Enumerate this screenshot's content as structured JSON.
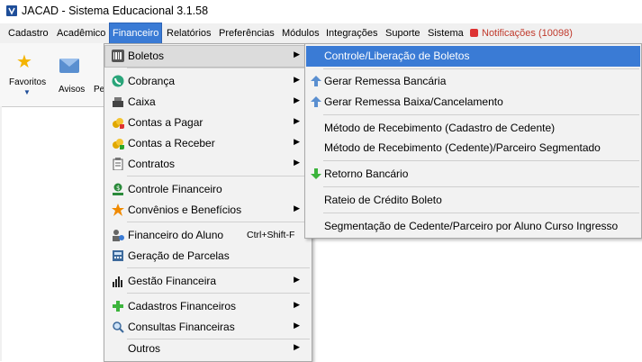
{
  "window": {
    "title": "JACAD - Sistema Educacional 3.1.58",
    "app_icon_color": "#1f4e99"
  },
  "menubar": {
    "items": [
      {
        "label": "Cadastro"
      },
      {
        "label": "Acadêmico"
      },
      {
        "label": "Financeiro",
        "active": true
      },
      {
        "label": "Relatórios"
      },
      {
        "label": "Preferências"
      },
      {
        "label": "Módulos"
      },
      {
        "label": "Integrações"
      },
      {
        "label": "Suporte"
      },
      {
        "label": "Sistema"
      }
    ],
    "notifications": "Notificações (10098)"
  },
  "toolbar": {
    "favoritos_label": "Favoritos",
    "avisos_label": "Avisos",
    "truncated_label": "Pe"
  },
  "financeiro_menu": {
    "items": [
      {
        "label": "Boletos",
        "icon": "barcode-icon",
        "submenu": true,
        "active": true
      },
      {
        "label": "Cobrança",
        "icon": "phone-icon",
        "submenu": true
      },
      {
        "label": "Caixa",
        "icon": "cash-register-icon",
        "submenu": true
      },
      {
        "label": "Contas a Pagar",
        "icon": "coins-pay-icon",
        "submenu": true
      },
      {
        "label": "Contas a Receber",
        "icon": "coins-receive-icon",
        "submenu": true
      },
      {
        "label": "Contratos",
        "icon": "clipboard-icon",
        "submenu": true
      },
      {
        "label": "Controle Financeiro",
        "icon": "money-hand-icon",
        "submenu": false
      },
      {
        "label": "Convênios e Benefícios",
        "icon": "star-icon",
        "submenu": true
      },
      {
        "label": "Financeiro do Aluno",
        "icon": "student-icon",
        "shortcut": "Ctrl+Shift-F",
        "submenu": false
      },
      {
        "label": "Geração de Parcelas",
        "icon": "calculator-icon",
        "submenu": false
      },
      {
        "label": "Gestão Financeira",
        "icon": "bar-chart-icon",
        "submenu": true
      },
      {
        "label": "Cadastros Financeiros",
        "icon": "plus-icon",
        "submenu": true
      },
      {
        "label": "Consultas Financeiras",
        "icon": "magnifier-icon",
        "submenu": true
      },
      {
        "label": "Outros",
        "icon": "",
        "submenu": true
      }
    ]
  },
  "boletos_menu": {
    "items": [
      {
        "label": "Controle/Liberação de Boletos",
        "icon": "",
        "highlight": true
      },
      {
        "label": "Gerar Remessa Bancária",
        "icon": "arrow-up-icon"
      },
      {
        "label": "Gerar Remessa Baixa/Cancelamento",
        "icon": "arrow-up-icon"
      },
      {
        "label": "Método de Recebimento (Cadastro de Cedente)",
        "icon": ""
      },
      {
        "label": "Método de Recebimento (Cedente)/Parceiro Segmentado",
        "icon": ""
      },
      {
        "label": "Retorno Bancário",
        "icon": "arrow-down-icon"
      },
      {
        "label": "Rateio de Crédito Boleto",
        "icon": ""
      },
      {
        "label": "Segmentação de Cedente/Parceiro por Aluno Curso Ingresso",
        "icon": ""
      }
    ]
  },
  "colors": {
    "highlight": "#3a7bd5",
    "notification": "#c0392b"
  }
}
